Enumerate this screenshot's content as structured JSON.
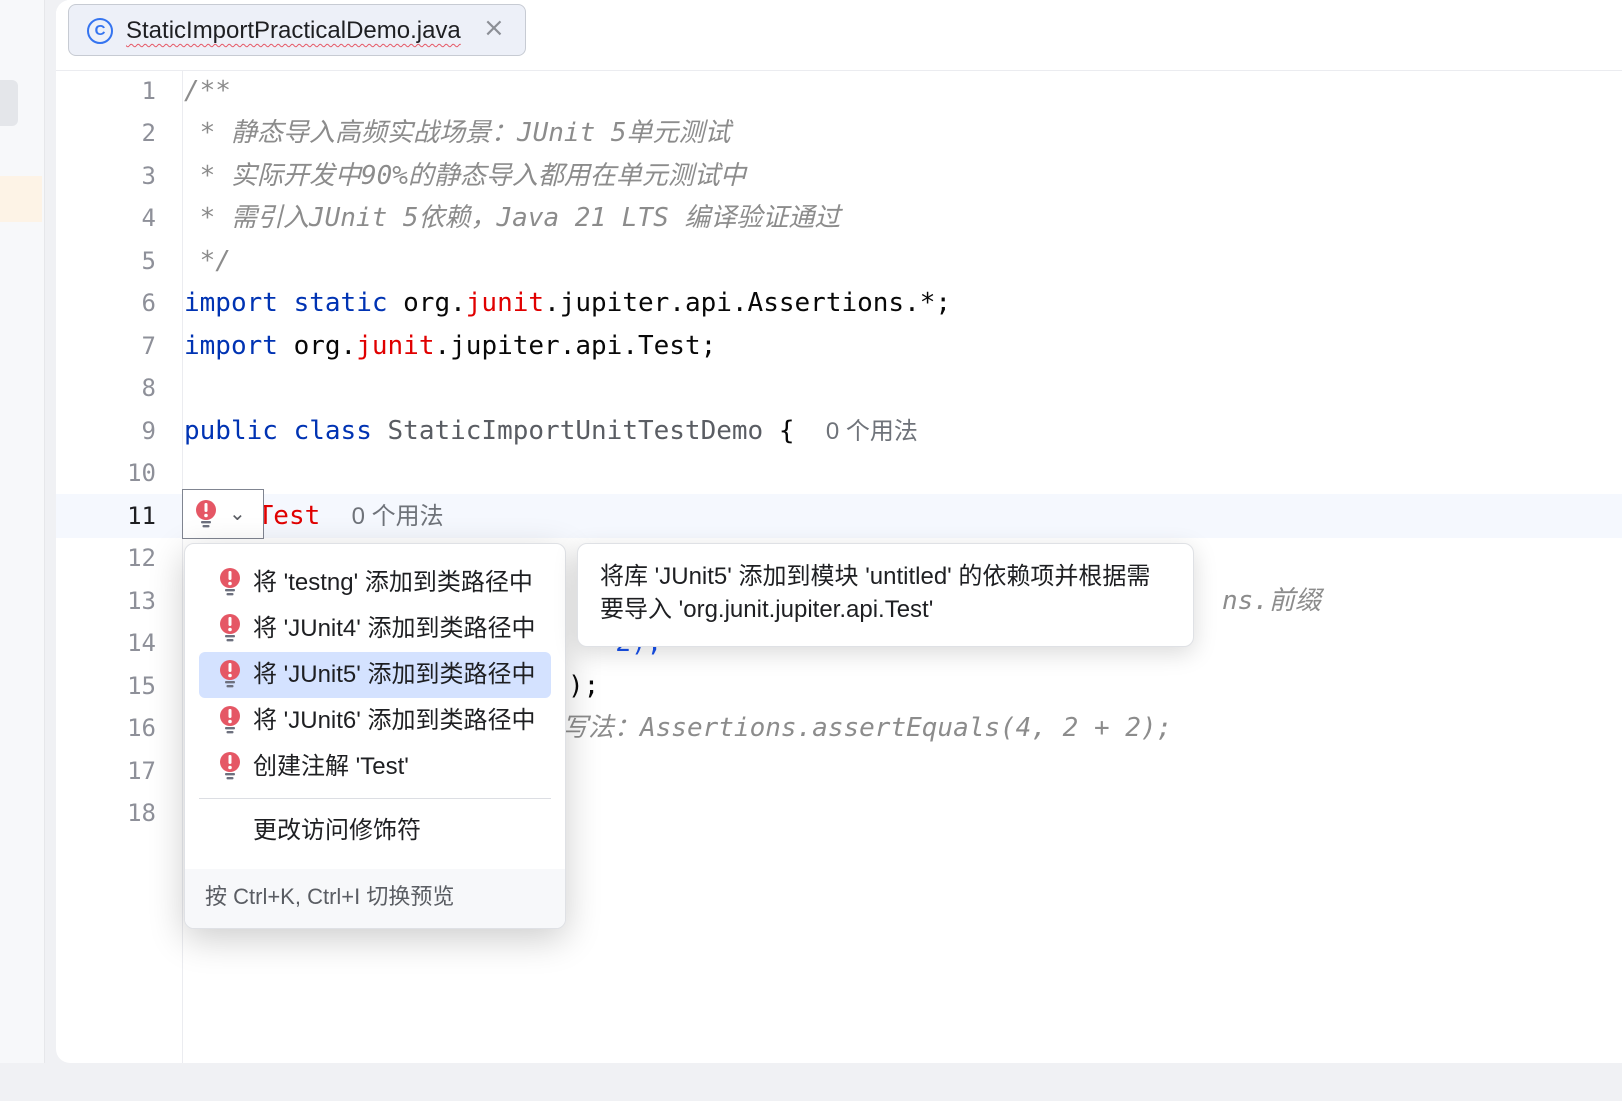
{
  "tab": {
    "filename": "StaticImportPracticalDemo.java",
    "icon": "class-c-icon",
    "close": "×"
  },
  "line_numbers": [
    "1",
    "2",
    "3",
    "4",
    "5",
    "6",
    "7",
    "8",
    "9",
    "10",
    "11",
    "12",
    "13",
    "14",
    "15",
    "16",
    "17",
    "18"
  ],
  "code": {
    "l1": "/**",
    "l2": " * 静态导入高频实战场景：JUnit 5单元测试",
    "l3": " * 实际开发中90%的静态导入都用在单元测试中",
    "l4": " * 需引入JUnit 5依赖，Java 21 LTS 编译验证通过",
    "l5": " */",
    "l6": {
      "kw1": "import",
      "kw2": "static",
      "pre": "org.",
      "red": "junit",
      "post": ".jupiter.api.Assertions.*;"
    },
    "l7": {
      "kw1": "import",
      "pre": "org.",
      "red": "junit",
      "post": ".jupiter.api.Test;"
    },
    "l9": {
      "kw1": "public",
      "kw2": "class",
      "name": "StaticImportUnitTestDemo",
      "brace": "{",
      "usage": "0 个用法"
    },
    "l11": {
      "at": "@",
      "ann": "Test",
      "usage": "0 个用法"
    },
    "l13_tail": "ns.前缀",
    "l14_tail": "' 2);",
    "l15_tail": ");",
    "l16_tail": "写法：Assertions.assertEquals(4, 2 + 2);"
  },
  "intention_popup": {
    "items": [
      {
        "label": "将 'testng' 添加到类路径中",
        "icon": "error-bulb-icon",
        "selected": false
      },
      {
        "label": "将 'JUnit4' 添加到类路径中",
        "icon": "error-bulb-icon",
        "selected": false
      },
      {
        "label": "将 'JUnit5' 添加到类路径中",
        "icon": "error-bulb-icon",
        "selected": true
      },
      {
        "label": "将 'JUnit6' 添加到类路径中",
        "icon": "error-bulb-icon",
        "selected": false
      },
      {
        "label": "创建注解 'Test'",
        "icon": "error-bulb-icon",
        "selected": false
      }
    ],
    "secondary": "更改访问修饰符",
    "footer": "按 Ctrl+K, Ctrl+I 切换预览"
  },
  "tooltip": {
    "line1": "将库 'JUnit5' 添加到模块 'untitled' 的依赖项并根据需",
    "line2": "要导入 'org.junit.jupiter.api.Test'"
  },
  "colors": {
    "keyword": "#0033b3",
    "error": "#e00000",
    "comment": "#8c8c8c",
    "selection": "#d4e2ff",
    "accent": "#3574f0"
  }
}
